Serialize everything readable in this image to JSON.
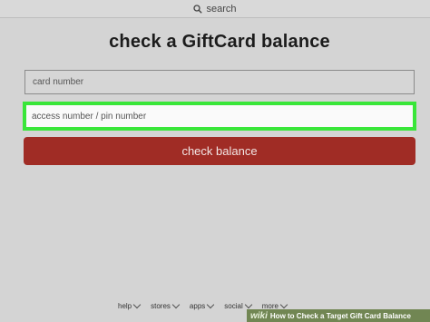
{
  "header": {
    "search_label": "search"
  },
  "page": {
    "title": "check a GiftCard balance"
  },
  "form": {
    "card_placeholder": "card number",
    "pin_placeholder": "access number / pin number",
    "submit_label": "check balance"
  },
  "footer": {
    "nav": [
      {
        "label": "help"
      },
      {
        "label": "stores"
      },
      {
        "label": "apps"
      },
      {
        "label": "social"
      },
      {
        "label": "more"
      }
    ]
  },
  "watermark": {
    "brand": "wiki",
    "title": "How to Check a Target Gift Card Balance"
  },
  "colors": {
    "button": "#a02c25",
    "highlight": "#39e639",
    "background": "#d4d4d4"
  }
}
